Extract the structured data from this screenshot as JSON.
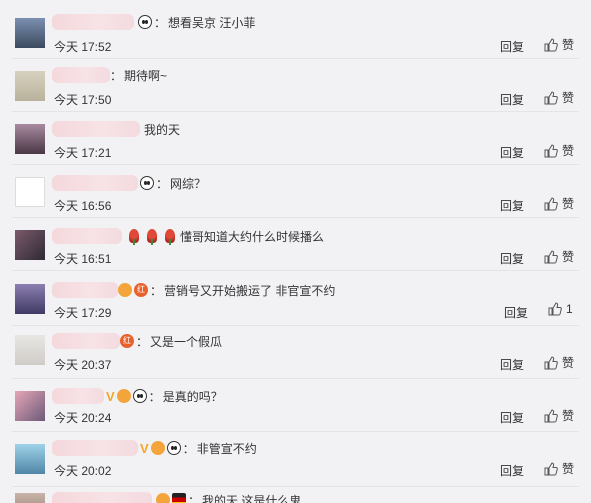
{
  "comments": [
    {
      "text": "想看吴京 汪小菲",
      "time": "今天 17:52",
      "reply": "回复",
      "like": "赞"
    },
    {
      "text": "期待啊~",
      "time": "今天 17:50",
      "reply": "回复",
      "like": "赞"
    },
    {
      "text": "我的天",
      "time": "今天 17:21",
      "reply": "回复",
      "like": "赞"
    },
    {
      "text": "网综？",
      "time": "今天 16:56",
      "reply": "回复",
      "like": "赞"
    },
    {
      "text": "懂哥知道大约什么时候播么",
      "time": "今天 16:51",
      "reply": "回复",
      "like": "赞"
    },
    {
      "text": "营销号又开始搬运了 非官宣不约",
      "time": "今天 17:29",
      "reply": "回复",
      "like": "1"
    },
    {
      "text": "又是一个假瓜",
      "time": "今天 20:37",
      "reply": "回复",
      "like": "赞"
    },
    {
      "text": "是真的吗？",
      "time": "今天 20:24",
      "reply": "回复",
      "like": "赞"
    },
    {
      "text": "非管宣不约",
      "time": "今天 20:02",
      "reply": "回复",
      "like": "赞"
    },
    {
      "text": "我的天 这是什么鬼",
      "time": "",
      "reply": "",
      "like": ""
    }
  ],
  "badges": {
    "hong": "红",
    "v": "V"
  },
  "colors": {
    "background": "#f2f2f5",
    "name_mask": "#f4d8dc",
    "divider": "#e4e4e8"
  }
}
